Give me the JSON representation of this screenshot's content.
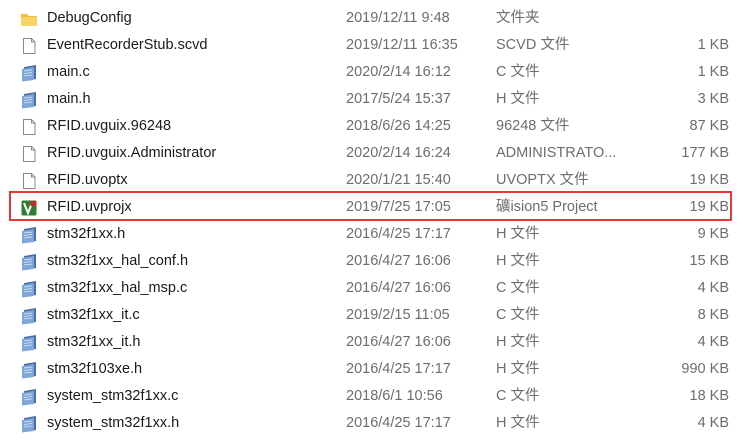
{
  "files": [
    {
      "icon": "folder-icon",
      "name": "DebugConfig",
      "date": "2019/12/11 9:48",
      "type": "文件夹",
      "size": ""
    },
    {
      "icon": "blank-file-icon",
      "name": "EventRecorderStub.scvd",
      "date": "2019/12/11 16:35",
      "type": "SCVD 文件",
      "size": "1 KB"
    },
    {
      "icon": "source-file-icon",
      "name": "main.c",
      "date": "2020/2/14 16:12",
      "type": "C 文件",
      "size": "1 KB"
    },
    {
      "icon": "source-file-icon",
      "name": "main.h",
      "date": "2017/5/24 15:37",
      "type": "H 文件",
      "size": "3 KB"
    },
    {
      "icon": "blank-file-icon",
      "name": "RFID.uvguix.96248",
      "date": "2018/6/26 14:25",
      "type": "96248 文件",
      "size": "87 KB"
    },
    {
      "icon": "blank-file-icon",
      "name": "RFID.uvguix.Administrator",
      "date": "2020/2/14 16:24",
      "type": "ADMINISTRATO...",
      "size": "177 KB"
    },
    {
      "icon": "blank-file-icon",
      "name": "RFID.uvoptx",
      "date": "2020/1/21 15:40",
      "type": "UVOPTX 文件",
      "size": "19 KB"
    },
    {
      "icon": "keil-project-icon",
      "name": "RFID.uvprojx",
      "date": "2019/7/25 17:05",
      "type": "礦ision5 Project",
      "size": "19 KB"
    },
    {
      "icon": "source-file-icon",
      "name": "stm32f1xx.h",
      "date": "2016/4/25 17:17",
      "type": "H 文件",
      "size": "9 KB"
    },
    {
      "icon": "source-file-icon",
      "name": "stm32f1xx_hal_conf.h",
      "date": "2016/4/27 16:06",
      "type": "H 文件",
      "size": "15 KB"
    },
    {
      "icon": "source-file-icon",
      "name": "stm32f1xx_hal_msp.c",
      "date": "2016/4/27 16:06",
      "type": "C 文件",
      "size": "4 KB"
    },
    {
      "icon": "source-file-icon",
      "name": "stm32f1xx_it.c",
      "date": "2019/2/15 11:05",
      "type": "C 文件",
      "size": "8 KB"
    },
    {
      "icon": "source-file-icon",
      "name": "stm32f1xx_it.h",
      "date": "2016/4/27 16:06",
      "type": "H 文件",
      "size": "4 KB"
    },
    {
      "icon": "source-file-icon",
      "name": "stm32f103xe.h",
      "date": "2016/4/25 17:17",
      "type": "H 文件",
      "size": "990 KB"
    },
    {
      "icon": "source-file-icon",
      "name": "system_stm32f1xx.c",
      "date": "2018/6/1 10:56",
      "type": "C 文件",
      "size": "18 KB"
    },
    {
      "icon": "source-file-icon",
      "name": "system_stm32f1xx.h",
      "date": "2016/4/25 17:17",
      "type": "H 文件",
      "size": "4 KB"
    }
  ],
  "highlighted_file": "RFID.uvprojx",
  "colors": {
    "highlight_border": "#e53935",
    "folder": "#f2c037",
    "secondary_text": "#6d6d6d"
  }
}
